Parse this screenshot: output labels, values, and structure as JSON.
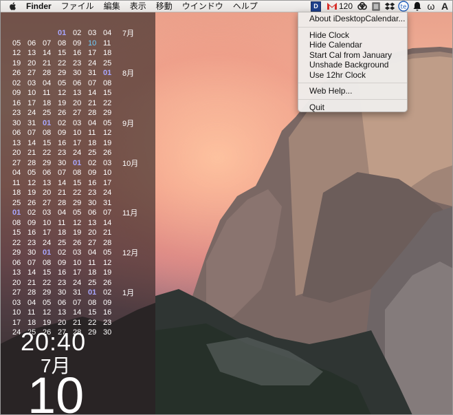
{
  "menubar": {
    "app_name": "Finder",
    "menus": [
      "ファイル",
      "編集",
      "表示",
      "移動",
      "ウインドウ",
      "ヘルプ"
    ],
    "status_icons": [
      "idesktopcalendar-icon",
      "gmail-icon",
      "creative-cloud-icon",
      "trash-icon",
      "dropbox-icon",
      "textexpander-icon",
      "notification-bell-icon",
      "omega-icon",
      "font-icon"
    ],
    "gmail_count": "120",
    "idc_label": "D"
  },
  "calendar": {
    "rows": [
      {
        "days": [
          "",
          "",
          "",
          "01",
          "02",
          "03",
          "04"
        ],
        "month": "7月"
      },
      {
        "days": [
          "05",
          "06",
          "07",
          "08",
          "09",
          "10",
          "11"
        ],
        "month": ""
      },
      {
        "days": [
          "12",
          "13",
          "14",
          "15",
          "16",
          "17",
          "18"
        ],
        "month": ""
      },
      {
        "days": [
          "19",
          "20",
          "21",
          "22",
          "23",
          "24",
          "25"
        ],
        "month": ""
      },
      {
        "days": [
          "26",
          "27",
          "28",
          "29",
          "30",
          "31",
          "01"
        ],
        "month": "8月"
      },
      {
        "days": [
          "02",
          "03",
          "04",
          "05",
          "06",
          "07",
          "08"
        ],
        "month": ""
      },
      {
        "days": [
          "09",
          "10",
          "11",
          "12",
          "13",
          "14",
          "15"
        ],
        "month": ""
      },
      {
        "days": [
          "16",
          "17",
          "18",
          "19",
          "20",
          "21",
          "22"
        ],
        "month": ""
      },
      {
        "days": [
          "23",
          "24",
          "25",
          "26",
          "27",
          "28",
          "29"
        ],
        "month": ""
      },
      {
        "days": [
          "30",
          "31",
          "01",
          "02",
          "03",
          "04",
          "05"
        ],
        "month": "9月"
      },
      {
        "days": [
          "06",
          "07",
          "08",
          "09",
          "10",
          "11",
          "12"
        ],
        "month": ""
      },
      {
        "days": [
          "13",
          "14",
          "15",
          "16",
          "17",
          "18",
          "19"
        ],
        "month": ""
      },
      {
        "days": [
          "20",
          "21",
          "22",
          "23",
          "24",
          "25",
          "26"
        ],
        "month": ""
      },
      {
        "days": [
          "27",
          "28",
          "29",
          "30",
          "01",
          "02",
          "03"
        ],
        "month": "10月"
      },
      {
        "days": [
          "04",
          "05",
          "06",
          "07",
          "08",
          "09",
          "10"
        ],
        "month": ""
      },
      {
        "days": [
          "11",
          "12",
          "13",
          "14",
          "15",
          "16",
          "17"
        ],
        "month": ""
      },
      {
        "days": [
          "18",
          "19",
          "20",
          "21",
          "22",
          "23",
          "24"
        ],
        "month": ""
      },
      {
        "days": [
          "25",
          "26",
          "27",
          "28",
          "29",
          "30",
          "31"
        ],
        "month": ""
      },
      {
        "days": [
          "01",
          "02",
          "03",
          "04",
          "05",
          "06",
          "07"
        ],
        "month": "11月"
      },
      {
        "days": [
          "08",
          "09",
          "10",
          "11",
          "12",
          "13",
          "14"
        ],
        "month": ""
      },
      {
        "days": [
          "15",
          "16",
          "17",
          "18",
          "19",
          "20",
          "21"
        ],
        "month": ""
      },
      {
        "days": [
          "22",
          "23",
          "24",
          "25",
          "26",
          "27",
          "28"
        ],
        "month": ""
      },
      {
        "days": [
          "29",
          "30",
          "01",
          "02",
          "03",
          "04",
          "05"
        ],
        "month": "12月"
      },
      {
        "days": [
          "06",
          "07",
          "08",
          "09",
          "10",
          "11",
          "12"
        ],
        "month": ""
      },
      {
        "days": [
          "13",
          "14",
          "15",
          "16",
          "17",
          "18",
          "19"
        ],
        "month": ""
      },
      {
        "days": [
          "20",
          "21",
          "22",
          "23",
          "24",
          "25",
          "26"
        ],
        "month": ""
      },
      {
        "days": [
          "27",
          "28",
          "29",
          "30",
          "31",
          "01",
          "02"
        ],
        "month": "1月"
      },
      {
        "days": [
          "03",
          "04",
          "05",
          "06",
          "07",
          "08",
          "09"
        ],
        "month": ""
      },
      {
        "days": [
          "10",
          "11",
          "12",
          "13",
          "14",
          "15",
          "16"
        ],
        "month": ""
      },
      {
        "days": [
          "17",
          "18",
          "19",
          "20",
          "21",
          "22",
          "23"
        ],
        "month": ""
      },
      {
        "days": [
          "24",
          "25",
          "26",
          "27",
          "28",
          "29",
          "30"
        ],
        "month": ""
      }
    ],
    "today": "10",
    "highlight_color": "#a8a7ff",
    "today_color": "#6fd0ff"
  },
  "clock": {
    "time": "20:40",
    "month": "7月",
    "day": "10"
  },
  "dropdown": {
    "sections": [
      [
        "About iDesktopCalendar..."
      ],
      [
        "Hide Clock",
        "Hide Calendar",
        "Start Cal from January",
        "Unshade Background",
        "Use 12hr Clock"
      ],
      [
        "Web Help..."
      ],
      [
        "Quit"
      ]
    ]
  }
}
